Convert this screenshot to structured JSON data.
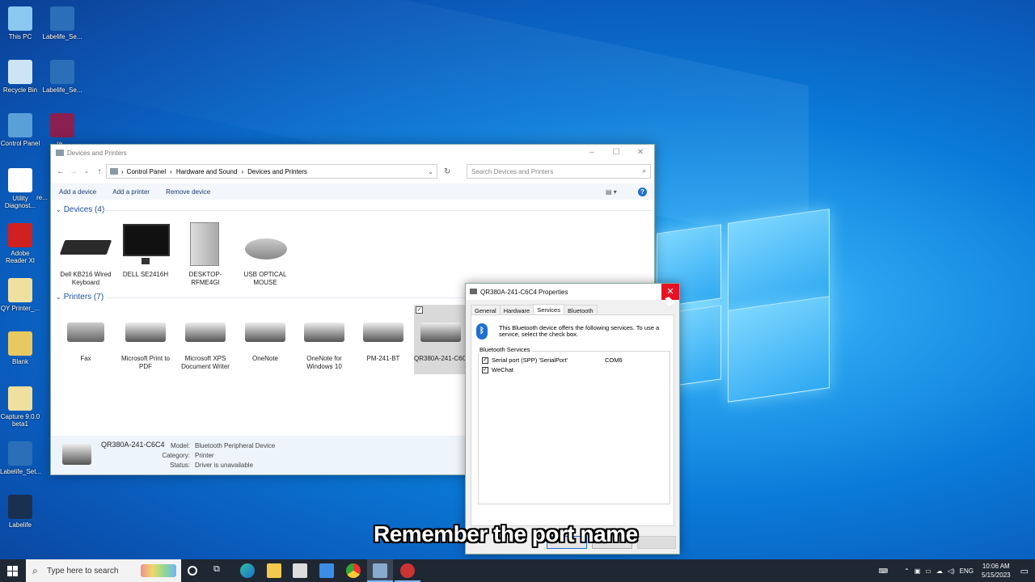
{
  "desktop": {
    "icons": [
      {
        "label": "This PC"
      },
      {
        "label": "Labelife_Se..."
      },
      {
        "label": "Recycle Bin"
      },
      {
        "label": "Labelife_Se..."
      },
      {
        "label": "Control Panel"
      },
      {
        "label": "re..."
      },
      {
        "label": "Utility Diagnost..."
      },
      {
        "label": "re..."
      },
      {
        "label": "Adobe Reader XI"
      },
      {
        "label": "QY Printer_..."
      },
      {
        "label": "Blank"
      },
      {
        "label": "Capture 9.0.0 beta1"
      },
      {
        "label": "Labelife_Set..."
      },
      {
        "label": "Labelife"
      }
    ]
  },
  "explorer": {
    "title": "Devices and Printers",
    "breadcrumb": [
      "Control Panel",
      "Hardware and Sound",
      "Devices and Printers"
    ],
    "search_placeholder": "Search Devices and Printers",
    "commands": [
      "Add a device",
      "Add a printer",
      "Remove device"
    ],
    "devices_header": "Devices (4)",
    "devices": [
      {
        "name": "Dell KB216 Wired Keyboard"
      },
      {
        "name": "DELL SE2416H"
      },
      {
        "name": "DESKTOP-RFME4GI"
      },
      {
        "name": "USB OPTICAL MOUSE"
      }
    ],
    "printers_header": "Printers (7)",
    "printers": [
      {
        "name": "Fax"
      },
      {
        "name": "Microsoft Print to PDF"
      },
      {
        "name": "Microsoft XPS Document Writer"
      },
      {
        "name": "OneNote"
      },
      {
        "name": "OneNote for Windows 10"
      },
      {
        "name": "PM-241-BT"
      },
      {
        "name": "QR380A-241-C6C4"
      }
    ],
    "status": {
      "device": "QR380A-241-C6C4",
      "model_label": "Model:",
      "model": "Bluetooth Peripheral Device",
      "category_label": "Category:",
      "category": "Printer",
      "status_label": "Status:",
      "status": "Driver is unavailable"
    }
  },
  "dialog": {
    "title": "QR380A-241-C6C4 Properties",
    "tabs": [
      "General",
      "Hardware",
      "Services",
      "Bluetooth"
    ],
    "active_tab": "Services",
    "info": "This Bluetooth device offers the following services. To use a service, select the check box.",
    "group_label": "Bluetooth Services",
    "services": [
      {
        "name": "Serial port (SPP) 'SerialPort'",
        "port": "COM6",
        "checked": true
      },
      {
        "name": "WeChat",
        "port": "",
        "checked": true
      }
    ]
  },
  "subtitle": "Remember the port name",
  "taskbar": {
    "search_placeholder": "Type here to search",
    "lang": "ENG",
    "time": "10:06 AM",
    "date": "5/15/2023"
  }
}
